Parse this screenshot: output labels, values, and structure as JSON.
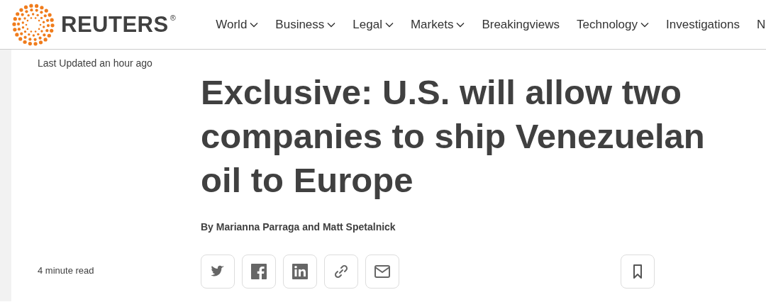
{
  "header": {
    "logo": "REUTERS",
    "registered": "®",
    "nav": [
      {
        "label": "World",
        "dropdown": true
      },
      {
        "label": "Business",
        "dropdown": true
      },
      {
        "label": "Legal",
        "dropdown": true
      },
      {
        "label": "Markets",
        "dropdown": true
      },
      {
        "label": "Breakingviews",
        "dropdown": false
      },
      {
        "label": "Technology",
        "dropdown": true
      },
      {
        "label": "Investigations",
        "dropdown": false
      },
      {
        "label": "N",
        "dropdown": false
      }
    ]
  },
  "article": {
    "updated": "Last Updated an hour ago",
    "headline": "Exclusive: U.S. will allow two companies to ship Venezuelan oil to Europe",
    "byline": "By Marianna Parraga and Matt Spetalnick",
    "read_time": "4 minute read",
    "share": [
      {
        "kind": "twitter"
      },
      {
        "kind": "facebook"
      },
      {
        "kind": "linkedin"
      },
      {
        "kind": "link"
      },
      {
        "kind": "email"
      }
    ]
  }
}
